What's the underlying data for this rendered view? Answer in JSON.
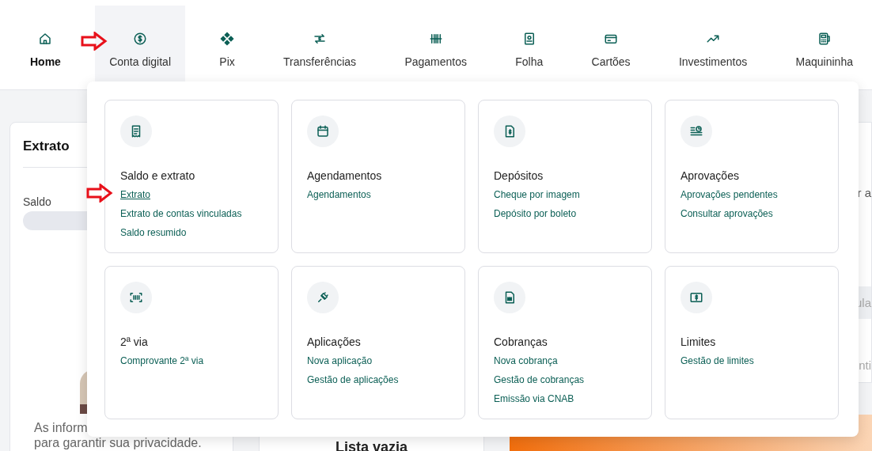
{
  "nav": [
    {
      "label": "Home",
      "current": true,
      "open": false
    },
    {
      "label": "Conta digital",
      "current": false,
      "open": true
    },
    {
      "label": "Pix",
      "current": false,
      "open": false
    },
    {
      "label": "Transferências",
      "current": false,
      "open": false
    },
    {
      "label": "Pagamentos",
      "current": false,
      "open": false
    },
    {
      "label": "Folha",
      "current": false,
      "open": false
    },
    {
      "label": "Cartões",
      "current": false,
      "open": false
    },
    {
      "label": "Investimentos",
      "current": false,
      "open": false
    },
    {
      "label": "Maquininha",
      "current": false,
      "open": false
    }
  ],
  "background": {
    "statement_card": {
      "title": "Extrato",
      "balance_label": "Saldo",
      "message_lines": [
        "As inform",
        "para garantir sua privacidade."
      ]
    },
    "empty_list": {
      "title": "Lista vazia"
    },
    "right_fragments": [
      "r a",
      "ula",
      "nti"
    ]
  },
  "menu": [
    {
      "title": "Saldo e extrato",
      "links": [
        {
          "label": "Extrato",
          "selected": true
        },
        {
          "label": "Extrato de contas vinculadas",
          "selected": false
        },
        {
          "label": "Saldo resumido",
          "selected": false
        }
      ]
    },
    {
      "title": "Agendamentos",
      "links": [
        {
          "label": "Agendamentos",
          "selected": false
        }
      ]
    },
    {
      "title": "Depósitos",
      "links": [
        {
          "label": "Cheque por imagem",
          "selected": false
        },
        {
          "label": "Depósito por boleto",
          "selected": false
        }
      ]
    },
    {
      "title": "Aprovações",
      "links": [
        {
          "label": "Aprovações pendentes",
          "selected": false
        },
        {
          "label": "Consultar aprovações",
          "selected": false
        }
      ]
    },
    {
      "title": "2ª via",
      "links": [
        {
          "label": "Comprovante 2ª via",
          "selected": false
        }
      ]
    },
    {
      "title": "Aplicações",
      "links": [
        {
          "label": "Nova aplicação",
          "selected": false
        },
        {
          "label": "Gestão de aplicações",
          "selected": false
        }
      ]
    },
    {
      "title": "Cobranças",
      "links": [
        {
          "label": "Nova cobrança",
          "selected": false
        },
        {
          "label": "Gestão de cobranças",
          "selected": false
        },
        {
          "label": "Emissão via CNAB",
          "selected": false
        }
      ]
    },
    {
      "title": "Limites",
      "links": [
        {
          "label": "Gestão de limites",
          "selected": false
        }
      ]
    }
  ]
}
